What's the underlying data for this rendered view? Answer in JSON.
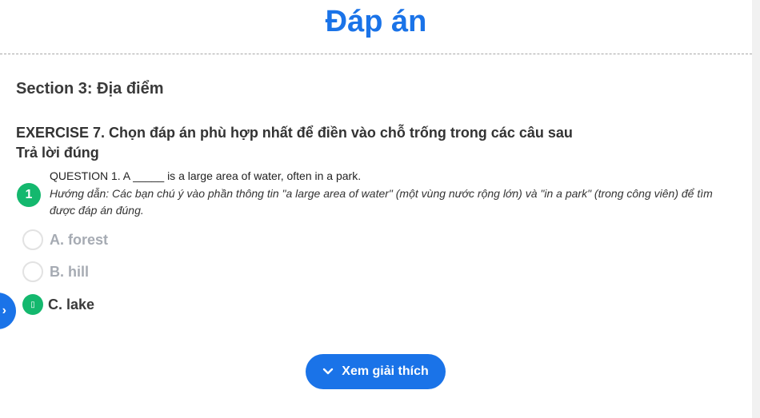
{
  "page_title": "Đáp án",
  "section_title": "Section 3: Địa điểm",
  "exercise": {
    "title": "EXERCISE 7. Chọn đáp án phù hợp nhất để điền vào chỗ trống trong các câu sau",
    "result_label": "Trả lời đúng"
  },
  "question": {
    "number": "1",
    "text": "QUESTION 1. A _____ is a large area of water, often in a park.",
    "hint": "Hướng dẫn: Các bạn chú ý vào phần thông tin \"a large area of water\" (một vùng nước rộng lớn) và \"in a park\" (trong công viên) để tìm được đáp án đúng.",
    "options": [
      {
        "label": "A. forest",
        "state": "unselected"
      },
      {
        "label": "B. hill",
        "state": "unselected"
      },
      {
        "label": "C. lake",
        "state": "correct-selected"
      }
    ]
  },
  "selected_mark_glyph": "▯",
  "side_tab_glyph": "›",
  "explain_button_label": "Xem giải thích",
  "colors": {
    "accent": "#1a73e8",
    "correct": "#14b86e",
    "muted_option": "#a6abb3"
  }
}
